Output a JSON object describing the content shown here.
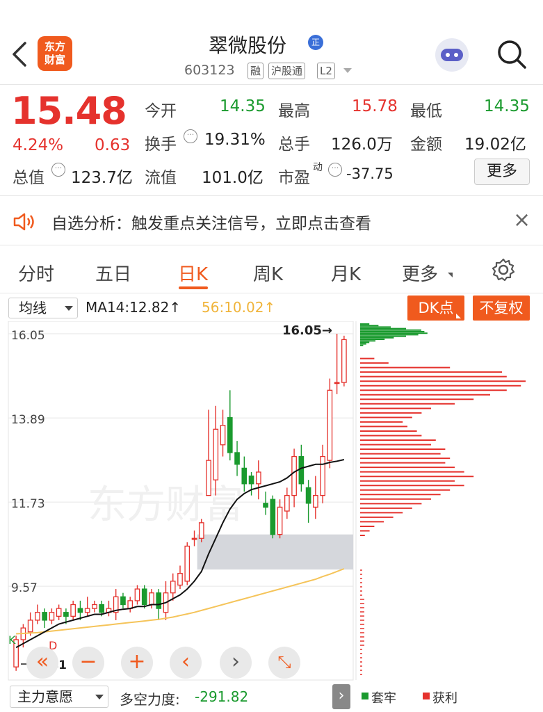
{
  "header": {
    "back_icon": "chevron-left-icon",
    "logo_line1": "东方",
    "logo_line2": "财富",
    "stock_name": "翠微股份",
    "badge": "正",
    "code": "603123",
    "tags": [
      "融",
      "沪股通",
      "L2"
    ],
    "assistant_icon": "robot-assistant-icon",
    "search_icon": "search-icon"
  },
  "quote": {
    "price": "15.48",
    "change_pct": "4.24%",
    "change_amt": "0.63",
    "open_label": "今开",
    "open": "14.35",
    "high_label": "最高",
    "high": "15.78",
    "low_label": "最低",
    "low": "14.35",
    "turnover_label": "换手",
    "turnover": "19.31%",
    "volume_label": "总手",
    "volume": "126.0万",
    "amount_label": "金额",
    "amount": "19.02亿",
    "mktcap_label": "总值",
    "mktcap": "123.7亿",
    "float_label": "流值",
    "float_cap": "101.0亿",
    "pe_label": "市盈",
    "pe_sup": "动",
    "pe": "-37.75",
    "more_label": "更多"
  },
  "notice": {
    "text": "自选分析：触发重点关注信号，立即点击查看",
    "close": "×"
  },
  "tabs": [
    "分时",
    "五日",
    "日K",
    "周K",
    "月K",
    "更多"
  ],
  "chart_toolbar": {
    "ma_select": "均线",
    "ma14": "MA14:12.82↑",
    "ma56": "56:10.02↑",
    "dk_button": "DK点",
    "fq_button": "不复权"
  },
  "chart_data": {
    "type": "candlestick",
    "y_ticks": [
      "16.05",
      "13.89",
      "11.73",
      "9.57"
    ],
    "ylim": [
      7.2,
      16.3
    ],
    "max_label": "16.05→",
    "min_label": "7.41",
    "watermark": "东方财富",
    "markers": [
      "K",
      "D"
    ],
    "candles": [
      {
        "o": 7.5,
        "c": 8.2,
        "h": 8.3,
        "l": 7.4
      },
      {
        "o": 8.2,
        "c": 8.5,
        "h": 8.6,
        "l": 8.0
      },
      {
        "o": 8.4,
        "c": 8.7,
        "h": 8.9,
        "l": 8.3
      },
      {
        "o": 8.7,
        "c": 8.9,
        "h": 9.1,
        "l": 8.6
      },
      {
        "o": 8.9,
        "c": 8.7,
        "h": 9.0,
        "l": 8.5
      },
      {
        "o": 8.7,
        "c": 8.9,
        "h": 9.0,
        "l": 8.6
      },
      {
        "o": 8.8,
        "c": 9.0,
        "h": 9.1,
        "l": 8.7
      },
      {
        "o": 8.9,
        "c": 8.8,
        "h": 9.0,
        "l": 8.6
      },
      {
        "o": 8.8,
        "c": 9.1,
        "h": 9.2,
        "l": 8.7
      },
      {
        "o": 9.0,
        "c": 8.9,
        "h": 9.2,
        "l": 8.7
      },
      {
        "o": 8.9,
        "c": 9.0,
        "h": 9.3,
        "l": 8.8
      },
      {
        "o": 9.0,
        "c": 9.1,
        "h": 9.2,
        "l": 8.9
      },
      {
        "o": 9.1,
        "c": 8.9,
        "h": 9.2,
        "l": 8.8
      },
      {
        "o": 8.9,
        "c": 9.0,
        "h": 9.2,
        "l": 8.8
      },
      {
        "o": 8.9,
        "c": 9.3,
        "h": 9.5,
        "l": 8.7
      },
      {
        "o": 9.3,
        "c": 9.1,
        "h": 9.4,
        "l": 9.0
      },
      {
        "o": 9.0,
        "c": 9.2,
        "h": 9.3,
        "l": 8.9
      },
      {
        "o": 9.2,
        "c": 9.5,
        "h": 9.6,
        "l": 9.1
      },
      {
        "o": 9.5,
        "c": 9.1,
        "h": 9.6,
        "l": 9.0
      },
      {
        "o": 9.1,
        "c": 9.4,
        "h": 9.5,
        "l": 9.0
      },
      {
        "o": 9.4,
        "c": 9.0,
        "h": 9.5,
        "l": 8.7
      },
      {
        "o": 8.9,
        "c": 9.4,
        "h": 9.7,
        "l": 8.7
      },
      {
        "o": 9.4,
        "c": 9.7,
        "h": 9.9,
        "l": 9.2
      },
      {
        "o": 9.6,
        "c": 9.9,
        "h": 10.1,
        "l": 9.5
      },
      {
        "o": 9.7,
        "c": 10.6,
        "h": 10.7,
        "l": 9.6
      },
      {
        "o": 10.8,
        "c": 10.8,
        "h": 11.0,
        "l": 10.6
      },
      {
        "o": 10.8,
        "c": 11.2,
        "h": 11.3,
        "l": 10.7
      },
      {
        "o": 11.9,
        "c": 12.8,
        "h": 14.1,
        "l": 11.9
      },
      {
        "o": 12.3,
        "c": 13.6,
        "h": 14.2,
        "l": 11.9
      },
      {
        "o": 13.2,
        "c": 13.7,
        "h": 14.1,
        "l": 12.9
      },
      {
        "o": 13.9,
        "c": 13.0,
        "h": 14.6,
        "l": 12.8
      },
      {
        "o": 13.0,
        "c": 12.7,
        "h": 13.3,
        "l": 12.4
      },
      {
        "o": 12.6,
        "c": 12.2,
        "h": 12.9,
        "l": 12.0
      },
      {
        "o": 12.4,
        "c": 12.2,
        "h": 12.5,
        "l": 11.9
      },
      {
        "o": 12.2,
        "c": 12.5,
        "h": 12.8,
        "l": 11.8
      },
      {
        "o": 11.7,
        "c": 11.6,
        "h": 12.0,
        "l": 11.4
      },
      {
        "o": 11.8,
        "c": 10.9,
        "h": 11.9,
        "l": 10.8
      },
      {
        "o": 10.9,
        "c": 11.6,
        "h": 11.8,
        "l": 10.8
      },
      {
        "o": 11.5,
        "c": 11.9,
        "h": 12.1,
        "l": 11.3
      },
      {
        "o": 11.9,
        "c": 12.9,
        "h": 13.1,
        "l": 11.6
      },
      {
        "o": 12.9,
        "c": 12.2,
        "h": 13.2,
        "l": 12.0
      },
      {
        "o": 12.1,
        "c": 11.7,
        "h": 12.3,
        "l": 11.2
      },
      {
        "o": 11.6,
        "c": 11.9,
        "h": 12.4,
        "l": 11.3
      },
      {
        "o": 11.9,
        "c": 12.9,
        "h": 13.2,
        "l": 11.7
      },
      {
        "o": 12.8,
        "c": 14.6,
        "h": 14.9,
        "l": 12.6
      },
      {
        "o": 14.8,
        "c": 14.8,
        "h": 16.05,
        "l": 14.5
      },
      {
        "o": 14.8,
        "c": 15.9,
        "h": 16.0,
        "l": 14.7
      }
    ],
    "ma14": [
      8.0,
      8.1,
      8.2,
      8.3,
      8.4,
      8.5,
      8.6,
      8.65,
      8.7,
      8.75,
      8.8,
      8.85,
      8.85,
      8.9,
      8.95,
      8.98,
      9.0,
      9.05,
      9.05,
      9.1,
      9.1,
      9.15,
      9.25,
      9.35,
      9.5,
      9.7,
      9.95,
      10.4,
      10.8,
      11.2,
      11.55,
      11.8,
      11.95,
      12.05,
      12.1,
      12.15,
      12.2,
      12.25,
      12.35,
      12.5,
      12.6,
      12.65,
      12.7,
      12.7,
      12.75,
      12.78,
      12.82
    ],
    "ma56": [
      8.35,
      8.36,
      8.37,
      8.38,
      8.4,
      8.42,
      8.44,
      8.46,
      8.48,
      8.5,
      8.52,
      8.54,
      8.56,
      8.58,
      8.6,
      8.62,
      8.64,
      8.66,
      8.68,
      8.7,
      8.72,
      8.75,
      8.78,
      8.82,
      8.86,
      8.9,
      8.95,
      9.0,
      9.05,
      9.1,
      9.15,
      9.2,
      9.25,
      9.3,
      9.35,
      9.4,
      9.45,
      9.5,
      9.55,
      9.6,
      9.65,
      9.7,
      9.75,
      9.82,
      9.88,
      9.95,
      10.02
    ],
    "zone": {
      "low": 10.0,
      "high": 10.9
    },
    "profile_red": [
      0,
      0,
      0,
      6,
      12,
      38,
      60,
      62,
      70,
      68,
      62,
      55,
      48,
      40,
      30,
      26,
      22,
      18,
      20,
      24,
      26,
      32,
      30,
      36,
      34,
      38,
      36,
      40,
      44,
      48,
      40,
      44,
      38,
      34,
      30,
      26,
      22,
      18,
      14,
      10,
      6,
      4,
      2
    ],
    "profile_green": [
      6,
      12,
      20,
      30,
      40,
      42,
      44,
      38,
      30,
      22,
      16,
      10,
      6,
      4,
      2
    ],
    "profile_legend": [
      "套牢",
      "获利"
    ]
  },
  "controls": [
    "«",
    "−",
    "+",
    "‹",
    "›",
    "⤡"
  ],
  "bottom": {
    "select": "主力意愿",
    "power_label": "多空力度:",
    "power_value": "-291.82",
    "legend_green": "套牢",
    "legend_red": "获利"
  },
  "colors": {
    "up": "#e5322d",
    "down": "#1a9a2e",
    "accent": "#f05a1e"
  }
}
